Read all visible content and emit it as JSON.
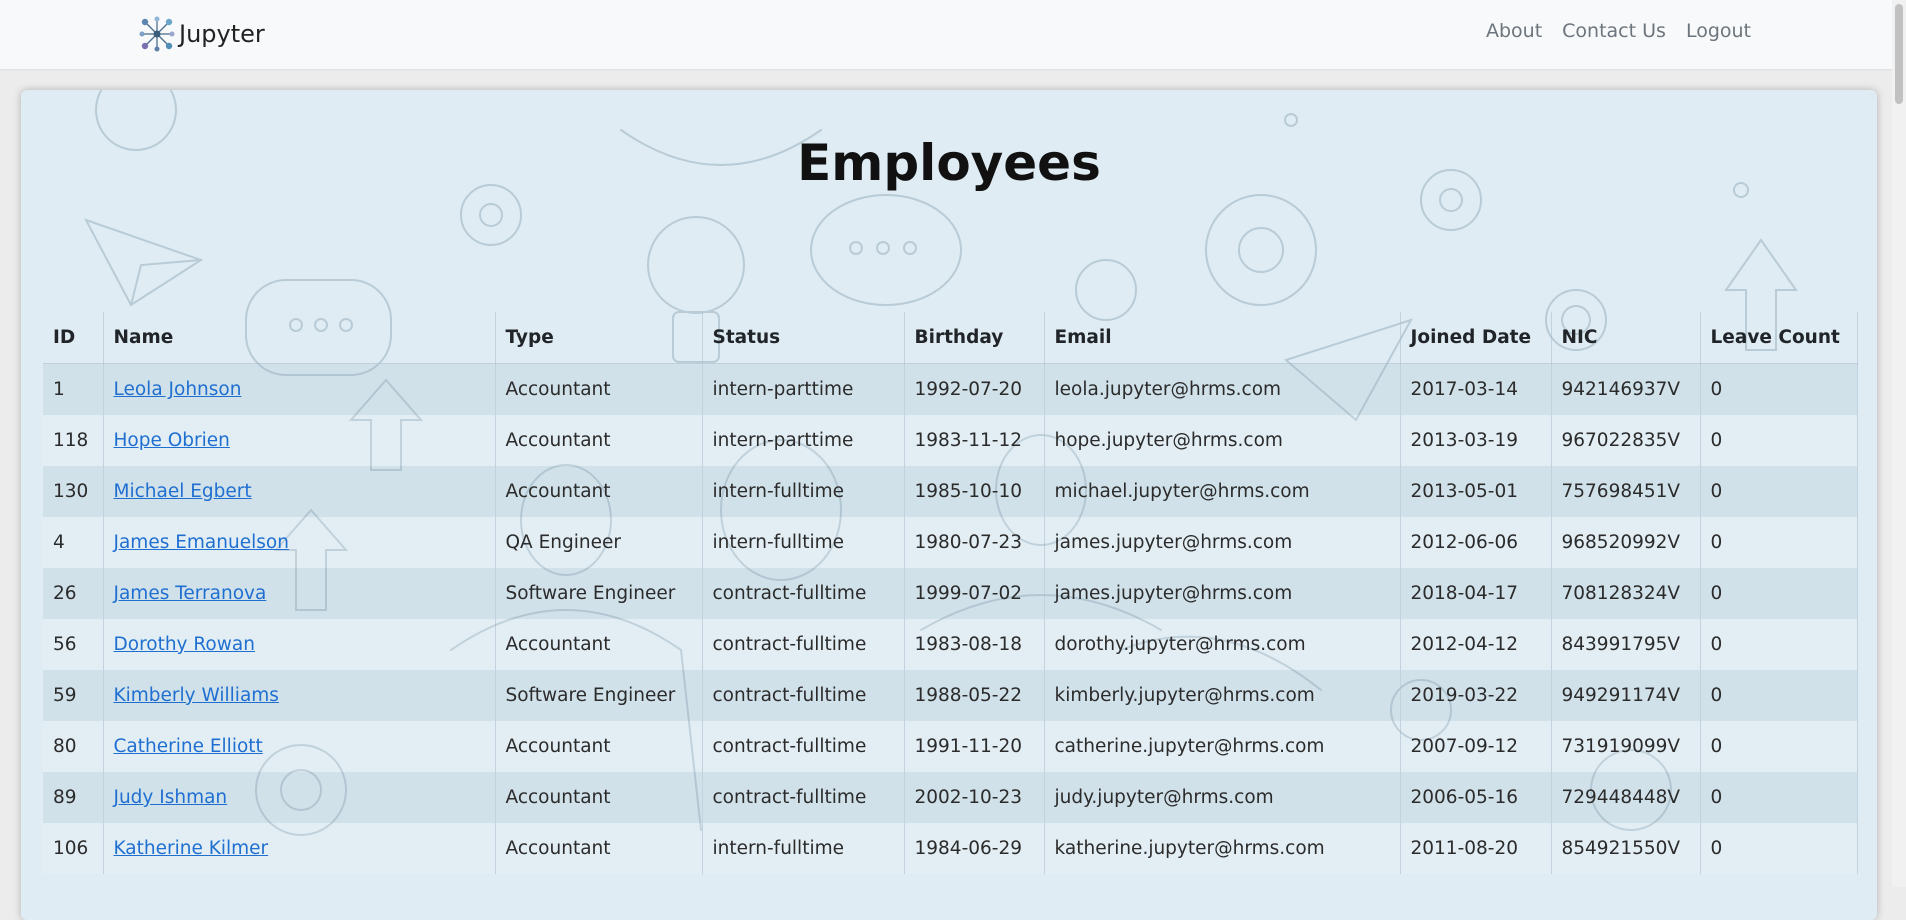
{
  "navbar": {
    "brand": "Jupyter",
    "links": [
      "About",
      "Contact Us",
      "Logout"
    ]
  },
  "page": {
    "title": "Employees"
  },
  "table": {
    "headers": [
      "ID",
      "Name",
      "Type",
      "Status",
      "Birthday",
      "Email",
      "Joined Date",
      "NIC",
      "Leave Count"
    ],
    "rows": [
      {
        "id": "1",
        "name": "Leola Johnson",
        "type": "Accountant",
        "status": "intern-parttime",
        "birthday": "1992-07-20",
        "email": "leola.jupyter@hrms.com",
        "joined": "2017-03-14",
        "nic": "942146937V",
        "leave": "0"
      },
      {
        "id": "118",
        "name": "Hope Obrien",
        "type": "Accountant",
        "status": "intern-parttime",
        "birthday": "1983-11-12",
        "email": "hope.jupyter@hrms.com",
        "joined": "2013-03-19",
        "nic": "967022835V",
        "leave": "0"
      },
      {
        "id": "130",
        "name": "Michael Egbert",
        "type": "Accountant",
        "status": "intern-fulltime",
        "birthday": "1985-10-10",
        "email": "michael.jupyter@hrms.com",
        "joined": "2013-05-01",
        "nic": "757698451V",
        "leave": "0"
      },
      {
        "id": "4",
        "name": "James Emanuelson",
        "type": "QA Engineer",
        "status": "intern-fulltime",
        "birthday": "1980-07-23",
        "email": "james.jupyter@hrms.com",
        "joined": "2012-06-06",
        "nic": "968520992V",
        "leave": "0"
      },
      {
        "id": "26",
        "name": "James Terranova",
        "type": "Software Engineer",
        "status": "contract-fulltime",
        "birthday": "1999-07-02",
        "email": "james.jupyter@hrms.com",
        "joined": "2018-04-17",
        "nic": "708128324V",
        "leave": "0"
      },
      {
        "id": "56",
        "name": "Dorothy Rowan",
        "type": "Accountant",
        "status": "contract-fulltime",
        "birthday": "1983-08-18",
        "email": "dorothy.jupyter@hrms.com",
        "joined": "2012-04-12",
        "nic": "843991795V",
        "leave": "0"
      },
      {
        "id": "59",
        "name": "Kimberly Williams",
        "type": "Software Engineer",
        "status": "contract-fulltime",
        "birthday": "1988-05-22",
        "email": "kimberly.jupyter@hrms.com",
        "joined": "2019-03-22",
        "nic": "949291174V",
        "leave": "0"
      },
      {
        "id": "80",
        "name": "Catherine Elliott",
        "type": "Accountant",
        "status": "contract-fulltime",
        "birthday": "1991-11-20",
        "email": "catherine.jupyter@hrms.com",
        "joined": "2007-09-12",
        "nic": "731919099V",
        "leave": "0"
      },
      {
        "id": "89",
        "name": "Judy Ishman",
        "type": "Accountant",
        "status": "contract-fulltime",
        "birthday": "2002-10-23",
        "email": "judy.jupyter@hrms.com",
        "joined": "2006-05-16",
        "nic": "729448448V",
        "leave": "0"
      },
      {
        "id": "106",
        "name": "Katherine Kilmer",
        "type": "Accountant",
        "status": "intern-fulltime",
        "birthday": "1984-06-29",
        "email": "katherine.jupyter@hrms.com",
        "joined": "2011-08-20",
        "nic": "854921550V",
        "leave": "0"
      }
    ]
  }
}
